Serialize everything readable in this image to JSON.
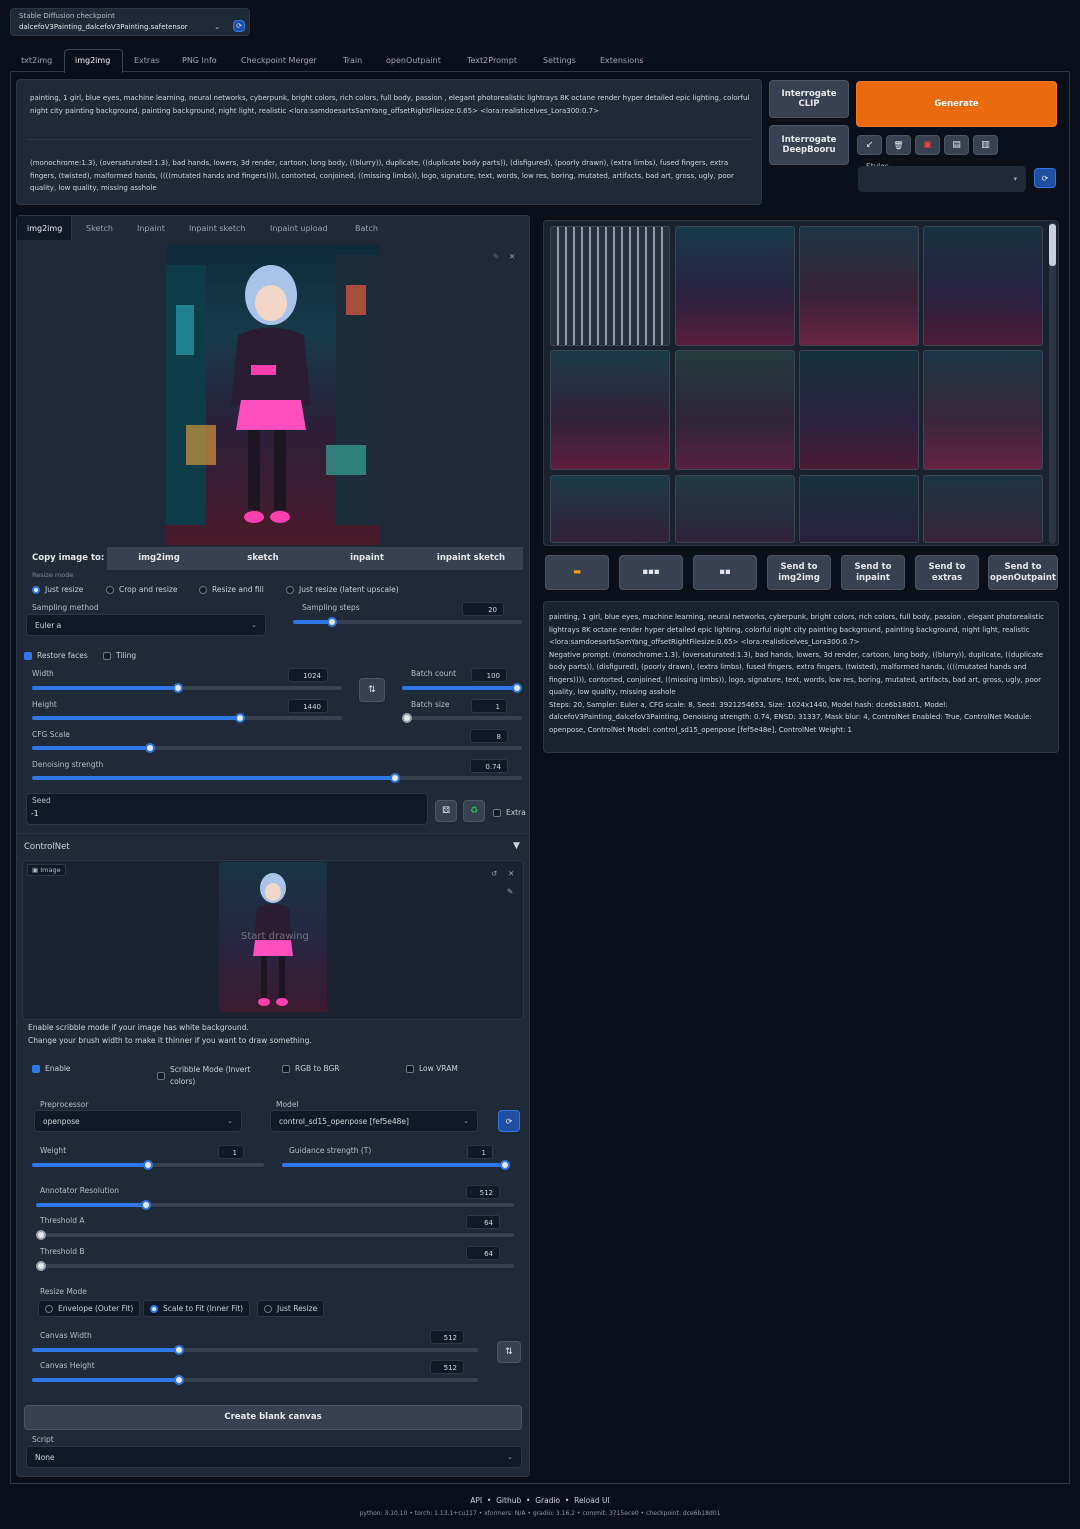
{
  "checkpoint": {
    "label": "Stable Diffusion checkpoint",
    "value": "dalcefoV3Painting_dalcefoV3Painting.safetensor"
  },
  "main_tabs": [
    "txt2img",
    "img2img",
    "Extras",
    "PNG Info",
    "Checkpoint Merger",
    "Train",
    "openOutpaint",
    "Text2Prompt",
    "Settings",
    "Extensions"
  ],
  "prompt": "painting, 1 girl, blue eyes, machine learning, neural networks, cyberpunk, bright colors, rich colors, full body, passion , elegant photorealistic lightrays 8K octane render hyper detailed epic lighting, colorful night city painting background, painting background, night light, realistic <lora:samdoesartsSamYang_offsetRightFilesize:0.65> <lora:realisticelves_Lora300:0.7>",
  "negative_prompt": "(monochrome:1.3), (oversaturated:1.3), bad hands, lowers, 3d render, cartoon, long body, ((blurry)), duplicate, ((duplicate body parts)), (disfigured), (poorly drawn), (extra limbs), fused fingers, extra fingers, (twisted), malformed hands, ((((mutated hands and fingers)))), contorted, conjoined, ((missing limbs)), logo, signature, text, words, low res, boring, mutated, artifacts, bad art, gross, ugly, poor quality, low quality, missing asshole",
  "interrogate_clip": "Interrogate CLIP",
  "interrogate_deepbooru": "Interrogate DeepBooru",
  "generate": "Generate",
  "styles_label": "Styles",
  "sub_tabs": [
    "img2img",
    "Sketch",
    "Inpaint",
    "Inpaint sketch",
    "Inpaint upload",
    "Batch"
  ],
  "copy_image_to": {
    "label": "Copy image to:",
    "buttons": [
      "img2img",
      "sketch",
      "inpaint",
      "inpaint sketch"
    ]
  },
  "resize_mode": {
    "label": "Resize mode",
    "options": [
      "Just resize",
      "Crop and resize",
      "Resize and fill",
      "Just resize (latent upscale)"
    ],
    "selected": "Just resize"
  },
  "sampling_method": {
    "label": "Sampling method",
    "value": "Euler a"
  },
  "sampling_steps": {
    "label": "Sampling steps",
    "value": "20",
    "fraction": 0.17
  },
  "restore_faces": "Restore faces",
  "tiling": "Tiling",
  "width": {
    "label": "Width",
    "value": "1024",
    "fraction": 0.47
  },
  "height": {
    "label": "Height",
    "value": "1440",
    "fraction": 0.67
  },
  "batch_count": {
    "label": "Batch count",
    "value": "100",
    "fraction": 1.0
  },
  "batch_size": {
    "label": "Batch size",
    "value": "1",
    "fraction": 0.0
  },
  "cfg_scale": {
    "label": "CFG Scale",
    "value": "8",
    "fraction": 0.24
  },
  "denoising": {
    "label": "Denoising strength",
    "value": "0.74",
    "fraction": 0.74
  },
  "seed": {
    "label": "Seed",
    "value": "-1"
  },
  "extra": "Extra",
  "controlnet": {
    "title": "ControlNet",
    "image_label": "Image",
    "overlay_text": "Start drawing",
    "hint1": "Enable scribble mode if your image has white background.",
    "hint2": "Change your brush width to make it thinner if you want to draw something.",
    "enable": "Enable",
    "scribble": "Scribble Mode (Invert colors)",
    "rgb_bgr": "RGB to BGR",
    "low_vram": "Low VRAM",
    "preprocessor": {
      "label": "Preprocessor",
      "value": "openpose"
    },
    "model": {
      "label": "Model",
      "value": "control_sd15_openpose [fef5e48e]"
    },
    "weight": {
      "label": "Weight",
      "value": "1",
      "fraction": 0.5
    },
    "guidance": {
      "label": "Guidance strength (T)",
      "value": "1",
      "fraction": 1.0
    },
    "annotator": {
      "label": "Annotator Resolution",
      "value": "512",
      "fraction": 0.23
    },
    "threshold_a": {
      "label": "Threshold A",
      "value": "64",
      "fraction": 0.0
    },
    "threshold_b": {
      "label": "Threshold B",
      "value": "64",
      "fraction": 0.0
    },
    "resize_mode": {
      "label": "Resize Mode",
      "options": [
        "Envelope (Outer Fit)",
        "Scale to Fit (Inner Fit)",
        "Just Resize"
      ],
      "selected": "Scale to Fit (Inner Fit)"
    },
    "canvas_width": {
      "label": "Canvas Width",
      "value": "512",
      "fraction": 0.33
    },
    "canvas_height": {
      "label": "Canvas Height",
      "value": "512",
      "fraction": 0.33
    },
    "create_canvas": "Create blank canvas"
  },
  "script": {
    "label": "Script",
    "value": "None"
  },
  "send_buttons": [
    "Send to img2img",
    "Send to inpaint",
    "Send to extras",
    "Send to openOutpaint"
  ],
  "generation_info": {
    "prompt": "painting, 1 girl, blue eyes, machine learning, neural networks, cyberpunk, bright colors, rich colors, full body, passion , elegant photorealistic lightrays 8K octane render hyper detailed epic lighting, colorful night city painting background, painting background, night light, realistic <lora:samdoesartsSamYang_offsetRightFilesize:0.65> <lora:realisticelves_Lora300:0.7>",
    "negative": "Negative prompt: (monochrome:1.3), (oversaturated:1.3), bad hands, lowers, 3d render, cartoon, long body, ((blurry)), duplicate, ((duplicate body parts)), (disfigured), (poorly drawn), (extra limbs), fused fingers, extra fingers, (twisted), malformed hands, ((((mutated hands and fingers)))), contorted, conjoined, ((missing limbs)), logo, signature, text, words, low res, boring, mutated, artifacts, bad art, gross, ugly, poor quality, low quality, missing asshole",
    "params": "Steps: 20, Sampler: Euler a, CFG scale: 8, Seed: 3921254653, Size: 1024x1440, Model hash: dce6b18d01, Model: dalcefoV3Painting_dalcefoV3Painting, Denoising strength: 0.74, ENSD: 31337, Mask blur: 4, ControlNet Enabled: True, ControlNet Module: openpose, ControlNet Model: control_sd15_openpose [fef5e48e], ControlNet Weight: 1"
  },
  "footer": {
    "links": [
      "API",
      "Github",
      "Gradio",
      "Reload UI"
    ],
    "versions": "python: 3.10.10  •  torch: 1.13.1+cu117  •  xformers: N/A  •  gradio: 3.16.2  •  commit: 3715ece0  •  checkpoint: dce6b18d01"
  },
  "colors": {
    "bg": "#0b0f19",
    "panel": "#1f2937",
    "accent": "#2f77e6",
    "generate": "#ea6a0c"
  },
  "icons": [
    "refresh-icon",
    "chevron-down-icon",
    "edit-icon",
    "close-icon",
    "trash-icon",
    "swap-icon",
    "dice-icon",
    "recycle-icon",
    "folder-icon",
    "save-icon",
    "zip-icon",
    "paint-icon"
  ]
}
